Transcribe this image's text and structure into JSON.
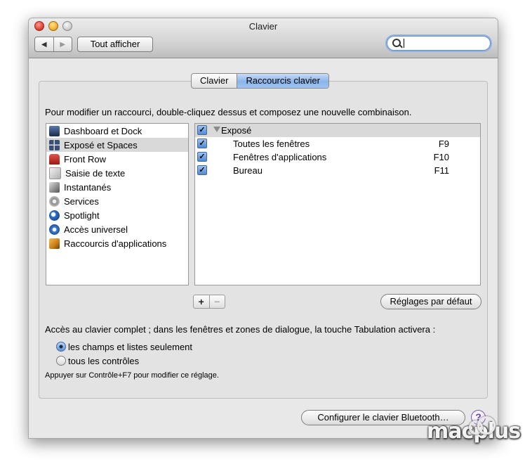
{
  "window": {
    "title": "Clavier"
  },
  "toolbar": {
    "show_all_label": "Tout afficher",
    "back_glyph": "◀",
    "forward_glyph": "▶"
  },
  "search": {
    "value": "",
    "placeholder": ""
  },
  "tabs": [
    {
      "label": "Clavier",
      "active": false
    },
    {
      "label": "Raccourcis clavier",
      "active": true
    }
  ],
  "instruction": "Pour modifier un raccourci, double-cliquez dessus et composez une nouvelle combinaison.",
  "categories": [
    {
      "label": "Dashboard et Dock",
      "icon": "dashboard-dock-icon",
      "color": "#2a3f66",
      "selected": false
    },
    {
      "label": "Exposé et Spaces",
      "icon": "expose-spaces-icon",
      "color": "#3a4f78",
      "selected": true
    },
    {
      "label": "Front Row",
      "icon": "front-row-icon",
      "color": "#c8261e",
      "selected": false
    },
    {
      "label": "Saisie de texte",
      "icon": "text-input-icon",
      "color": "#b8b8b8",
      "selected": false
    },
    {
      "label": "Instantanés",
      "icon": "screenshot-icon",
      "color": "#6a6a6a",
      "selected": false
    },
    {
      "label": "Services",
      "icon": "services-gear-icon",
      "color": "#8a8a8a",
      "selected": false
    },
    {
      "label": "Spotlight",
      "icon": "spotlight-icon",
      "color": "#2f6fc9",
      "selected": false
    },
    {
      "label": "Accès universel",
      "icon": "universal-access-icon",
      "color": "#2f6fc9",
      "selected": false
    },
    {
      "label": "Raccourcis d'applications",
      "icon": "app-shortcuts-icon",
      "color": "#c77b1a",
      "selected": false
    }
  ],
  "shortcuts": {
    "group": {
      "label": "Exposé",
      "checked": true
    },
    "items": [
      {
        "label": "Toutes les fenêtres",
        "key": "F9",
        "checked": true
      },
      {
        "label": "Fenêtres d'applications",
        "key": "F10",
        "checked": true
      },
      {
        "label": "Bureau",
        "key": "F11",
        "checked": true
      }
    ]
  },
  "list_buttons": {
    "plus": "+",
    "minus": "−"
  },
  "defaults_button": "Réglages par défaut",
  "full_keyboard_access": {
    "text": "Accès au clavier complet ; dans les fenêtres et zones de dialogue, la touche Tabulation activera :",
    "options": [
      {
        "label": "les champs et listes seulement",
        "selected": true
      },
      {
        "label": "tous les contrôles",
        "selected": false
      }
    ],
    "hint": "Appuyer sur Contrôle+F7 pour modifier ce réglage."
  },
  "bluetooth_button": "Configurer le clavier Bluetooth…",
  "help_button": "?",
  "watermark": {
    "text": "macplus"
  },
  "colors": {
    "selection_blue": "#8ab5ea",
    "checkbox_blue": "#4f8ad6"
  }
}
